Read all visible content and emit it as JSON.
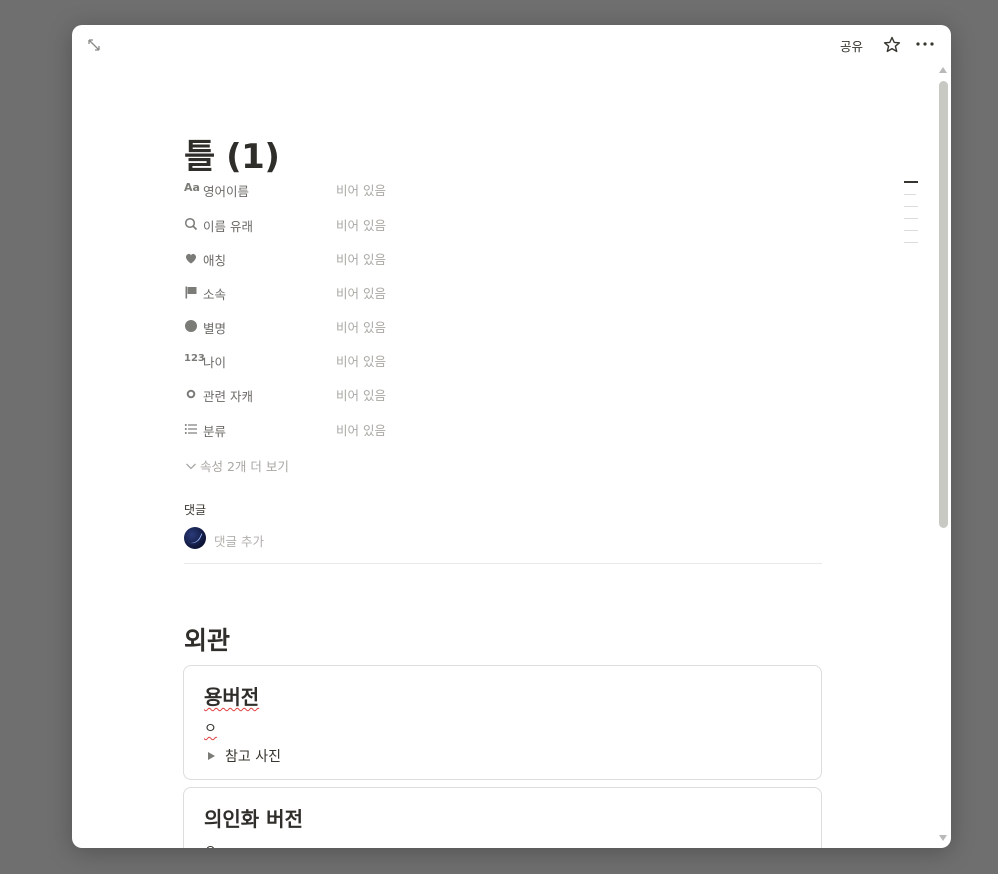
{
  "topbar": {
    "share_label": "공유"
  },
  "page": {
    "title": "틀 (1)"
  },
  "properties": [
    {
      "icon": "text-aa-icon",
      "icon_text": "Aa",
      "name": "영어이름",
      "value": "비어 있음"
    },
    {
      "icon": "search-icon",
      "name": "이름 유래",
      "value": "비어 있음"
    },
    {
      "icon": "heart-icon",
      "name": "애칭",
      "value": "비어 있음"
    },
    {
      "icon": "flag-icon",
      "name": "소속",
      "value": "비어 있음"
    },
    {
      "icon": "circle-filled-icon",
      "name": "별명",
      "value": "비어 있음"
    },
    {
      "icon": "number-icon",
      "icon_text": "123",
      "name": "나이",
      "value": "비어 있음"
    },
    {
      "icon": "relation-icon",
      "name": "관련 자캐",
      "value": "비어 있음"
    },
    {
      "icon": "list-icon",
      "name": "분류",
      "value": "비어 있음"
    }
  ],
  "more_properties_label": "속성 2개 더 보기",
  "comments": {
    "label": "댓글",
    "placeholder": "댓글 추가"
  },
  "section_heading": "외관",
  "cards": [
    {
      "title": "용버전",
      "bullet": "ㅇ",
      "toggle_label": "참고 사진"
    },
    {
      "title": "의인화 버전",
      "bullet": "ㅇ"
    }
  ],
  "colors": {
    "overlay": "#6f6f6f",
    "text": "#37352f",
    "muted": "#aaa9a4",
    "spellcheck": "#e03e3e"
  }
}
